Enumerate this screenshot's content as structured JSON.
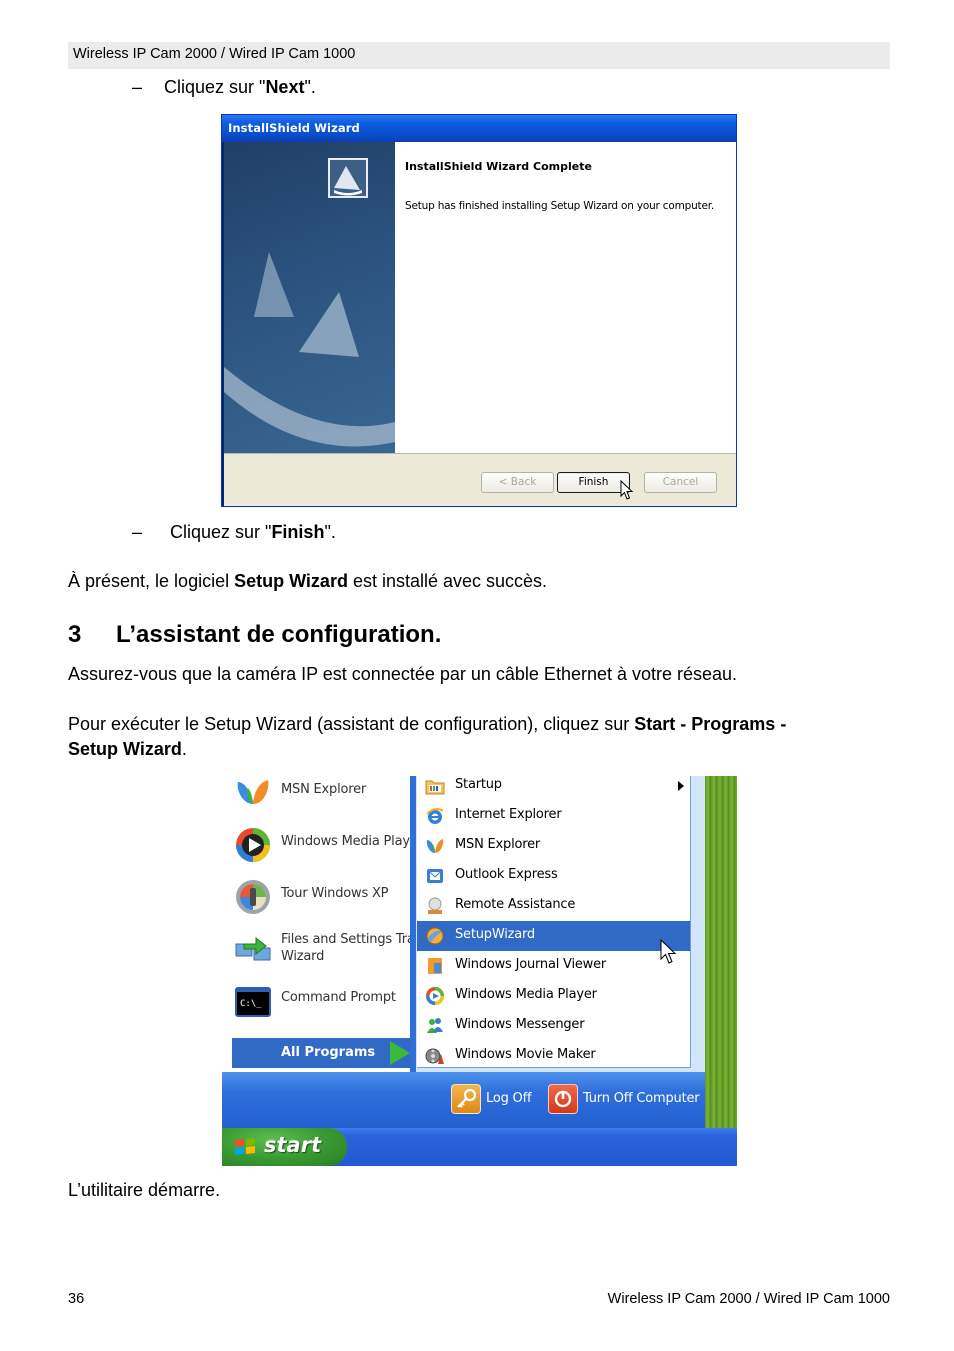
{
  "header": {
    "title": "Wireless IP Cam 2000 / Wired IP Cam 1000"
  },
  "steps": {
    "step_next": {
      "dash": "–",
      "prefix": "Cliquez sur \"",
      "bold": "Next",
      "suffix": "\"."
    },
    "step_finish": {
      "dash": "–",
      "prefix": "Cliquez sur \"",
      "bold": "Finish",
      "suffix": "\"."
    }
  },
  "installshield": {
    "window_title": "InstallShield Wizard",
    "heading": "InstallShield Wizard Complete",
    "message": "Setup has finished installing Setup Wizard on your computer.",
    "buttons": {
      "back": "< Back",
      "finish": "Finish",
      "cancel": "Cancel"
    },
    "icons": {
      "logo": "installshield-logo-icon",
      "cursor": "mouse-pointer-icon"
    }
  },
  "paragraphs": {
    "installed": {
      "prefix": "À présent, le logiciel ",
      "bold": "Setup Wizard",
      "suffix": " est installé avec succès."
    },
    "connect": "Assurez-vous que la caméra IP est connectée par un câble Ethernet à votre réseau.",
    "run": {
      "prefix": "Pour exécuter le Setup Wizard (assistant de configuration), cliquez sur ",
      "bold_line1": "Start - Programs -",
      "bold_line2": "Setup Wizard",
      "suffix": "."
    },
    "starts": "L’utilitaire démarre."
  },
  "section": {
    "number": "3",
    "title": "L’assistant de configuration."
  },
  "start_menu": {
    "pinned": [
      {
        "label": "MSN Explorer",
        "icon": "msn-butterfly-icon"
      },
      {
        "label": "Windows Media Player",
        "icon": "media-player-icon"
      },
      {
        "label": "Tour Windows XP",
        "icon": "tour-xp-icon"
      },
      {
        "label": "Files and Settings Transfer",
        "label2": "Wizard",
        "icon": "files-transfer-icon"
      },
      {
        "label": "Command Prompt",
        "icon": "command-prompt-icon"
      }
    ],
    "all_programs": "All Programs",
    "programs": [
      {
        "label": "Startup",
        "icon": "startup-folder-icon",
        "submenu": true
      },
      {
        "label": "Internet Explorer",
        "icon": "internet-explorer-icon"
      },
      {
        "label": "MSN Explorer",
        "icon": "msn-butterfly-icon"
      },
      {
        "label": "Outlook Express",
        "icon": "outlook-express-icon"
      },
      {
        "label": "Remote Assistance",
        "icon": "remote-assistance-icon"
      },
      {
        "label": "SetupWizard",
        "icon": "setup-wizard-icon",
        "selected": true
      },
      {
        "label": "Windows Journal Viewer",
        "icon": "journal-viewer-icon"
      },
      {
        "label": "Windows Media Player",
        "icon": "media-player-icon"
      },
      {
        "label": "Windows Messenger",
        "icon": "messenger-icon"
      },
      {
        "label": "Windows Movie Maker",
        "icon": "movie-maker-icon"
      }
    ],
    "log_off": "Log Off",
    "turn_off": "Turn Off Computer",
    "start": "start",
    "colors": {
      "highlight": "#316ac5",
      "start_button": "#3a9a34",
      "taskbar": "#2458d4"
    }
  },
  "footer": {
    "page_number": "36",
    "title": "Wireless IP Cam 2000 / Wired IP Cam 1000"
  }
}
